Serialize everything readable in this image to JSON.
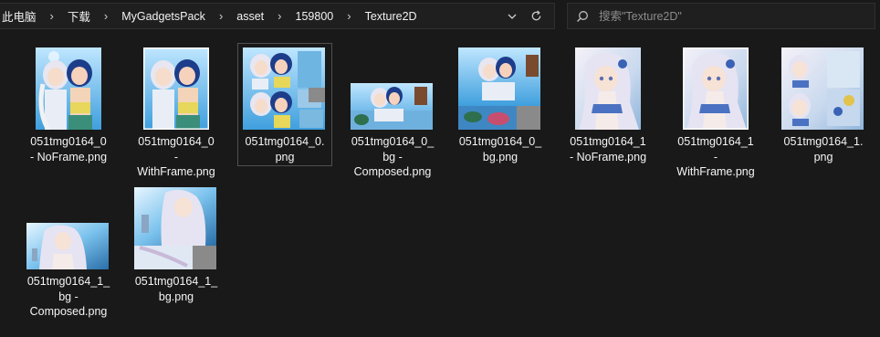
{
  "addressbar": {
    "crumbs": [
      "此电脑",
      "下载",
      "MyGadgetsPack",
      "asset",
      "159800",
      "Texture2D"
    ],
    "separator_icon": "chevron-right-icon",
    "history_icon": "chevron-down-icon",
    "refresh_icon": "refresh-icon"
  },
  "search": {
    "placeholder": "搜索\"Texture2D\"",
    "icon": "search-icon"
  },
  "colors": {
    "background": "#191919",
    "text": "#ffffff",
    "selection_border": "#505050",
    "transparent_area": "#8a8a8a"
  },
  "files": [
    {
      "name": "051tmg0164_0\n- NoFrame.png",
      "art": "duo",
      "selected": false
    },
    {
      "name": "051tmg0164_0\n-\nWithFrame.png",
      "art": "duo",
      "selected": false
    },
    {
      "name": "051tmg0164_0.\npng",
      "art": "duo-atlas",
      "selected": true
    },
    {
      "name": "051tmg0164_0_\nbg -\nComposed.png",
      "art": "beach-wide",
      "selected": false
    },
    {
      "name": "051tmg0164_0_\nbg.png",
      "art": "beach-atlas",
      "selected": false
    },
    {
      "name": "051tmg0164_1\n- NoFrame.png",
      "art": "solo",
      "selected": false
    },
    {
      "name": "051tmg0164_1\n-\nWithFrame.png",
      "art": "solo",
      "selected": false
    },
    {
      "name": "051tmg0164_1.\npng",
      "art": "solo-atlas",
      "selected": false
    },
    {
      "name": "051tmg0164_1_\nbg -\nComposed.png",
      "art": "solo-wide",
      "selected": false
    },
    {
      "name": "051tmg0164_1_\nbg.png",
      "art": "solo-bg-atlas",
      "selected": false
    }
  ]
}
